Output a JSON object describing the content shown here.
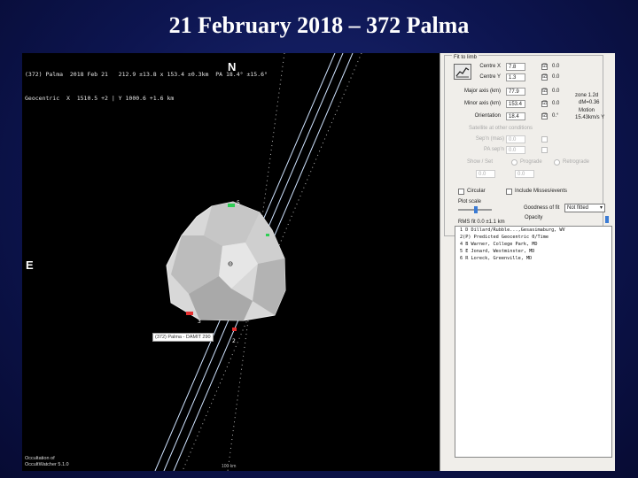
{
  "slide_title": "21 February 2018 – 372 Palma",
  "plot": {
    "header_lines": [
      "(372) Palma  2018 Feb 21   212.9 ±13.8 x 153.4 ±0.3km  PA 18.4° ±15.6°",
      "Geocentric  X  1510.5 +2 | Y 1000.6 +1.6 km"
    ],
    "compass_n": "N",
    "compass_e": "E",
    "chord_numbers": [
      "5",
      "3",
      "2"
    ],
    "model_tag": "(372) Palma - DAMIT 290",
    "footer_lines": [
      "Occultation of",
      "OccultWatcher 5.1.0"
    ],
    "scale_label": "100 km"
  },
  "panel": {
    "frame_title": "Fit to limb",
    "rows": [
      {
        "label": "Centre X",
        "value": "7.8",
        "check": "☑",
        "extra": "0.0"
      },
      {
        "label": "Centre Y",
        "value": "1.3",
        "check": "☑",
        "extra": "0.0"
      },
      {
        "label": "Major axis (km)",
        "value": "77.9",
        "check": "☑",
        "extra": "0.0"
      },
      {
        "label": "Minor axis (km)",
        "value": "153.4",
        "check": "☑",
        "extra": "0.0"
      },
      {
        "label": "Orientation",
        "value": "18.4",
        "check": "☑",
        "extra": "0.°"
      }
    ],
    "right_notes": [
      "zone 1.2d",
      "dM=0.36",
      "Motion",
      "15.43km/s  Y"
    ],
    "dim_section": {
      "title": "Satellite at other conditions",
      "rows": [
        {
          "label": "Sep'n (mas)",
          "value": "0.0"
        },
        {
          "label": "PA sep'n",
          "value": "0.0"
        }
      ]
    },
    "shape_row": {
      "label": "Show / Set",
      "opt1": "Prograde",
      "opt2": "Retrograde"
    },
    "coef_row": {
      "l": "0.0",
      "r": "0.0"
    },
    "checkbox_row": {
      "c1": "Circular",
      "c2": "Include Misses/events"
    },
    "plot_scale_label": "Plot scale",
    "goodness_label": "Goodness of fit",
    "fit_option": "Not fitted",
    "opacity_label": "Opacity",
    "rms_label": "RMS fit 0.0 ±1.1 km",
    "observers": [
      "1    D Dillard/Rubble...,Gesasimaburg, WV",
      "2(P) Predicted Geocentric 0/Time",
      "4    B Warner, College Park, MD",
      "5    E Jonard, Westminster, MD",
      "6    R Loreck, Greenville, MD"
    ]
  }
}
